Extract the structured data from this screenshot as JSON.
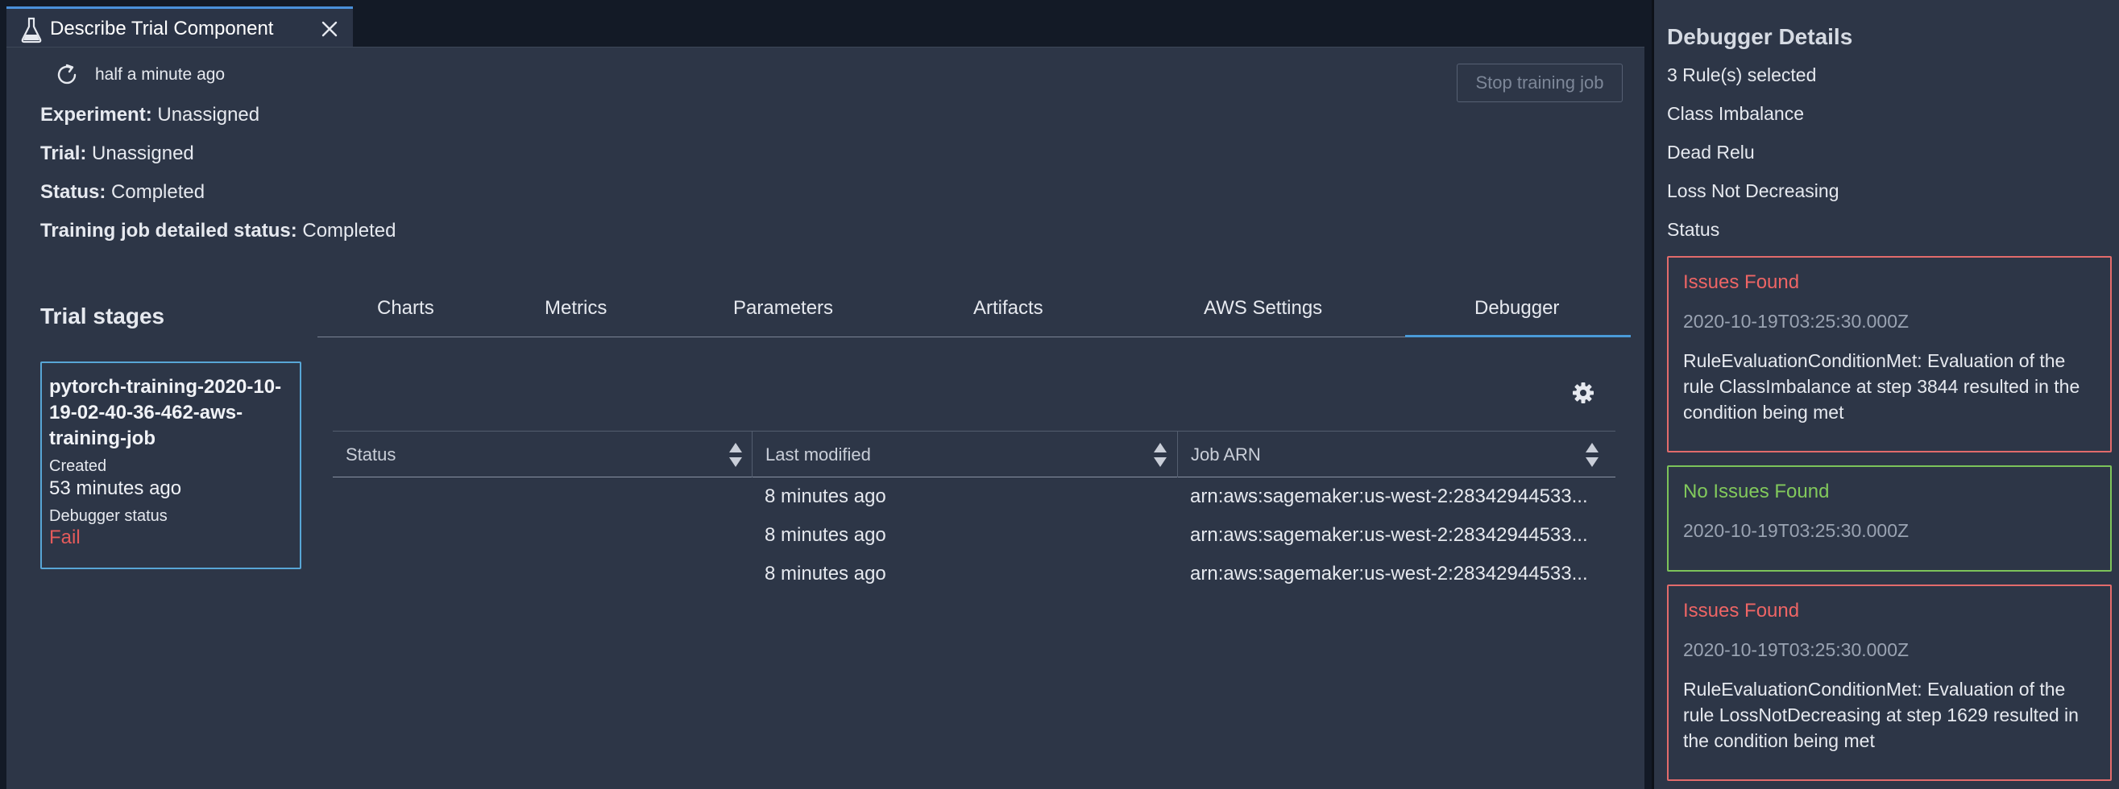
{
  "window": {
    "tab_title": "Describe Trial Component"
  },
  "header": {
    "refresh_time": "half a minute ago",
    "stop_button": "Stop training job"
  },
  "details": [
    {
      "label": "Experiment:",
      "value": "Unassigned"
    },
    {
      "label": "Trial:",
      "value": "Unassigned"
    },
    {
      "label": "Status:",
      "value": "Completed"
    },
    {
      "label": "Training job detailed status:",
      "value": "Completed"
    }
  ],
  "stages": {
    "title": "Trial stages",
    "card": {
      "name": "pytorch-training-2020-10-19-02-40-36-462-aws-training-job",
      "created_label": "Created",
      "created_value": "53 minutes ago",
      "debugger_label": "Debugger status",
      "debugger_value": "Fail"
    }
  },
  "tabs": [
    "Charts",
    "Metrics",
    "Parameters",
    "Artifacts",
    "AWS Settings",
    "Debugger"
  ],
  "active_tab": "Debugger",
  "table": {
    "columns": [
      "Status",
      "Last modified",
      "Job ARN"
    ],
    "rows": [
      {
        "status": "",
        "last_modified": "8 minutes ago",
        "job_arn": "arn:aws:sagemaker:us-west-2:28342944533..."
      },
      {
        "status": "",
        "last_modified": "8 minutes ago",
        "job_arn": "arn:aws:sagemaker:us-west-2:28342944533..."
      },
      {
        "status": "",
        "last_modified": "8 minutes ago",
        "job_arn": "arn:aws:sagemaker:us-west-2:28342944533..."
      }
    ]
  },
  "debugger": {
    "title": "Debugger Details",
    "rules_selected": "3 Rule(s) selected",
    "rules": [
      "Class Imbalance",
      "Dead Relu",
      "Loss Not Decreasing"
    ],
    "status_label": "Status",
    "cards": [
      {
        "status": "Issues Found",
        "time": "2020-10-19T03:25:30.000Z",
        "message": "RuleEvaluationConditionMet: Evaluation of the rule ClassImbalance at step 3844 resulted in the condition being met"
      },
      {
        "status": "No Issues Found",
        "time": "2020-10-19T03:25:30.000Z",
        "message": ""
      },
      {
        "status": "Issues Found",
        "time": "2020-10-19T03:25:30.000Z",
        "message": "RuleEvaluationConditionMet: Evaluation of the rule LossNotDecreasing at step 1629 resulted in the condition being met"
      }
    ]
  },
  "colors": {
    "background": "#2d3647",
    "accent": "#4a9ad8",
    "error": "#ee6565",
    "success": "#82c95c"
  },
  "icons": [
    "flask-icon",
    "close-icon",
    "refresh-icon",
    "gear-icon",
    "sort-icon"
  ]
}
